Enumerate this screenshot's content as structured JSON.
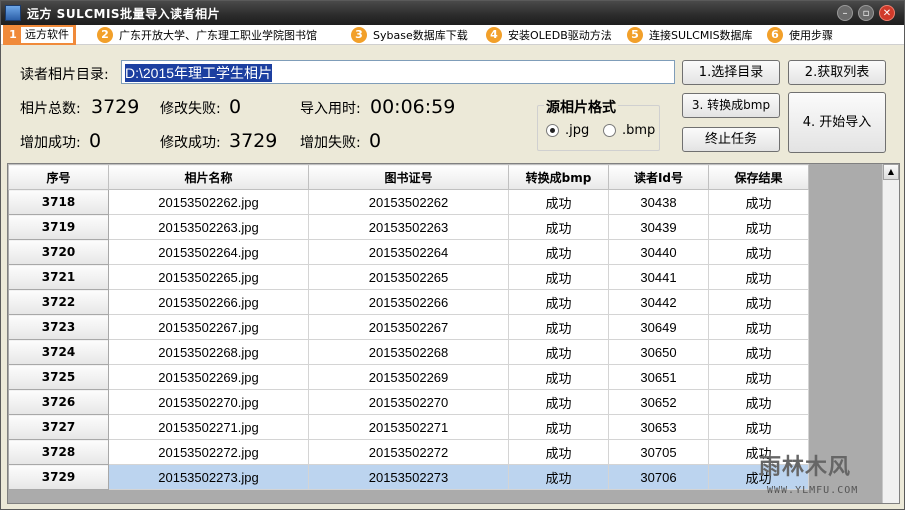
{
  "window": {
    "title": "远方 SULCMIS批量导入读者相片"
  },
  "menu": [
    {
      "num": "1",
      "label": "远方软件"
    },
    {
      "num": "2",
      "label": "广东开放大学、广东理工职业学院图书馆"
    },
    {
      "num": "3",
      "label": "Sybase数据库下载"
    },
    {
      "num": "4",
      "label": "安装OLEDB驱动方法"
    },
    {
      "num": "5",
      "label": "连接SULCMIS数据库"
    },
    {
      "num": "6",
      "label": "使用步骤"
    }
  ],
  "form": {
    "dir_label": "读者相片目录:",
    "dir_value": "D:\\2015年理工学生相片",
    "total_label": "相片总数:",
    "total_value": "3729",
    "add_success_label": "增加成功:",
    "add_success_value": "0",
    "modify_fail_label": "修改失败:",
    "modify_fail_value": "0",
    "modify_success_label": "修改成功:",
    "modify_success_value": "3729",
    "time_label": "导入用时:",
    "time_value": "00:06:59",
    "add_fail_label": "增加失败:",
    "add_fail_value": "0"
  },
  "format": {
    "legend": "源相片格式",
    "options": [
      ".jpg",
      ".bmp"
    ],
    "selected": ".jpg"
  },
  "buttons": {
    "select_dir": "1.选择目录",
    "get_list": "2.获取列表",
    "convert_bmp": "3. 转换成bmp",
    "stop_task": "终止任务",
    "start_import": "4. 开始导入"
  },
  "table": {
    "headers": [
      "序号",
      "相片名称",
      "图书证号",
      "转换成bmp",
      "读者Id号",
      "保存结果"
    ],
    "rows": [
      [
        "3718",
        "20153502262.jpg",
        "20153502262",
        "成功",
        "30438",
        "成功"
      ],
      [
        "3719",
        "20153502263.jpg",
        "20153502263",
        "成功",
        "30439",
        "成功"
      ],
      [
        "3720",
        "20153502264.jpg",
        "20153502264",
        "成功",
        "30440",
        "成功"
      ],
      [
        "3721",
        "20153502265.jpg",
        "20153502265",
        "成功",
        "30441",
        "成功"
      ],
      [
        "3722",
        "20153502266.jpg",
        "20153502266",
        "成功",
        "30442",
        "成功"
      ],
      [
        "3723",
        "20153502267.jpg",
        "20153502267",
        "成功",
        "30649",
        "成功"
      ],
      [
        "3724",
        "20153502268.jpg",
        "20153502268",
        "成功",
        "30650",
        "成功"
      ],
      [
        "3725",
        "20153502269.jpg",
        "20153502269",
        "成功",
        "30651",
        "成功"
      ],
      [
        "3726",
        "20153502270.jpg",
        "20153502270",
        "成功",
        "30652",
        "成功"
      ],
      [
        "3727",
        "20153502271.jpg",
        "20153502271",
        "成功",
        "30653",
        "成功"
      ],
      [
        "3728",
        "20153502272.jpg",
        "20153502272",
        "成功",
        "30705",
        "成功"
      ],
      [
        "3729",
        "20153502273.jpg",
        "20153502273",
        "成功",
        "30706",
        "成功"
      ]
    ],
    "selected_row": 11
  },
  "watermark": {
    "text": "雨林木风",
    "url": "WWW.YLMFU.COM"
  },
  "colors": {
    "accent": "#f08a3a",
    "menu_num": "#f2a02a",
    "selection": "#bcd4ef",
    "title_bg": "#2b2b2b"
  }
}
